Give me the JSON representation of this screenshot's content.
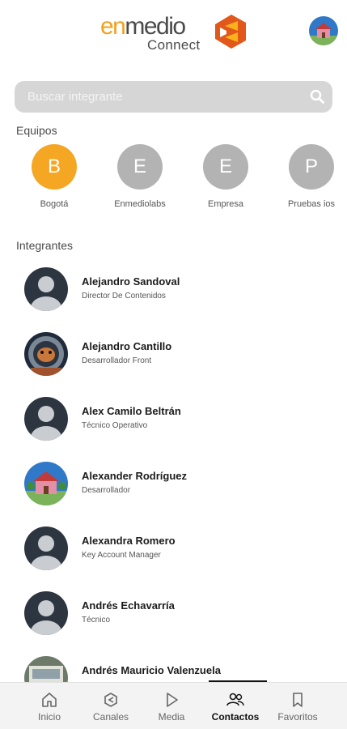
{
  "header": {
    "logo_word_en": "en",
    "logo_word_medio": "medio",
    "logo_sub": "Connect",
    "avatar_icon": "user-avatar-icon"
  },
  "search": {
    "placeholder": "Buscar integrante",
    "icon": "search-icon"
  },
  "teams_section": {
    "label": "Equipos",
    "teams": [
      {
        "initial": "B",
        "name": "Bogotá",
        "color": "#f5a623"
      },
      {
        "initial": "E",
        "name": "Enmediolabs",
        "color": "#b3b3b3"
      },
      {
        "initial": "E",
        "name": "Empresa",
        "color": "#b3b3b3"
      },
      {
        "initial": "P",
        "name": "Pruebas ios",
        "color": "#b3b3b3"
      }
    ]
  },
  "members_section": {
    "label": "Integrantes",
    "members": [
      {
        "name": "Alejandro Sandoval",
        "role": "Director De Contenidos",
        "avatar": "default"
      },
      {
        "name": "Alejandro Cantillo",
        "role": "Desarrollador Front",
        "avatar": "astronaut"
      },
      {
        "name": "Alex Camilo Beltrán",
        "role": "Técnico Operativo",
        "avatar": "default"
      },
      {
        "name": "Alexander Rodríguez",
        "role": "Desarrollador",
        "avatar": "house"
      },
      {
        "name": "Alexandra Romero",
        "role": "Key Account Manager",
        "avatar": "default"
      },
      {
        "name": "Andrés Echavarría",
        "role": "Técnico",
        "avatar": "default"
      },
      {
        "name": "Andrés Mauricio Valenzuela",
        "role": "",
        "avatar": "desk"
      }
    ]
  },
  "nav": {
    "items": [
      {
        "label": "Inicio",
        "icon": "home-icon"
      },
      {
        "label": "Canales",
        "icon": "channels-icon"
      },
      {
        "label": "Media",
        "icon": "play-icon"
      },
      {
        "label": "Contactos",
        "icon": "contacts-icon",
        "active": true
      },
      {
        "label": "Favoritos",
        "icon": "bookmark-icon"
      }
    ]
  },
  "colors": {
    "accent": "#f5a623",
    "team_inactive": "#b3b3b3",
    "default_avatar_bg": "#2d3540"
  }
}
